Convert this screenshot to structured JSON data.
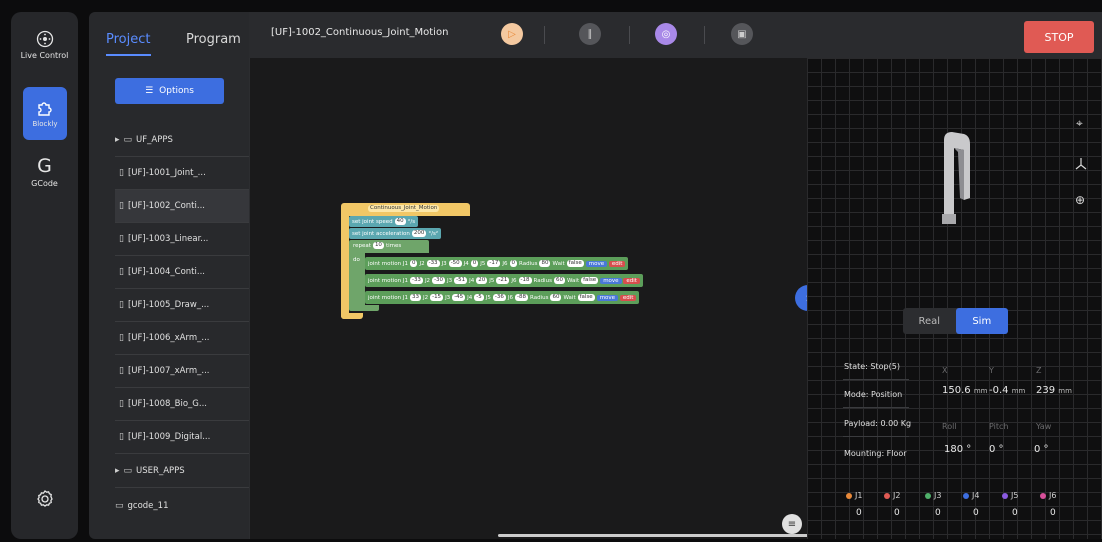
{
  "rail": {
    "live_control": "Live Control",
    "blockly": "Blockly",
    "gcode_glyph": "G",
    "gcode": "GCode"
  },
  "tabs": {
    "project": "Project",
    "program": "Program"
  },
  "options_label": "Options",
  "tree": {
    "uf_apps": "UF_APPS",
    "files": [
      "[UF]-1001_Joint_...",
      "[UF]-1002_Conti...",
      "[UF]-1003_Linear...",
      "[UF]-1004_Conti...",
      "[UF]-1005_Draw_...",
      "[UF]-1006_xArm_...",
      "[UF]-1007_xArm_...",
      "[UF]-1008_Bio_G...",
      "[UF]-1009_Digital..."
    ],
    "user_apps": "USER_APPS",
    "gcode_file": "gcode_11"
  },
  "toolbar": {
    "title": "[UF]-1002_Continuous_Joint_Motion",
    "stop": "STOP"
  },
  "blocks": {
    "func_name": "Continuous_Joint_Motion",
    "speed_label": "set joint speed",
    "speed_val": "40",
    "speed_unit": "°/s",
    "acc_label": "set joint acceleration",
    "acc_val": "200",
    "acc_unit": "°/s²",
    "repeat_label": "repeat",
    "repeat_val": "10",
    "times": "times",
    "do": "do",
    "motions": [
      {
        "j": [
          "0",
          "-33",
          "-50",
          "0",
          "-17",
          "0"
        ],
        "radius": "80",
        "wait": "false",
        "move": "move",
        "edit": "edit"
      },
      {
        "j": [
          "-33",
          "-30",
          "-51",
          "20",
          "-21",
          "-18"
        ],
        "radius": "60",
        "wait": "false",
        "move": "move",
        "edit": "edit"
      },
      {
        "j": [
          "33",
          "-15",
          "-45",
          "-5",
          "-36",
          "-88"
        ],
        "radius": "60",
        "wait": "false",
        "move": "move",
        "edit": "edit"
      }
    ]
  },
  "sim": {
    "real": "Real",
    "sim": "Sim",
    "state": "State: Stop(5)",
    "mode": "Mode: Position",
    "payload": "Payload: 0.00 Kg",
    "mounting": "Mounting: Floor",
    "x_label": "X",
    "y_label": "Y",
    "z_label": "Z",
    "x": "150.6",
    "x_unit": "mm",
    "y": "-0.4",
    "y_unit": "mm",
    "z": "239",
    "z_unit": "mm",
    "roll_label": "Roll",
    "pitch_label": "Pitch",
    "yaw_label": "Yaw",
    "roll": "180 °",
    "pitch": "0 °",
    "yaw": "0 °",
    "joints": [
      {
        "name": "J1",
        "value": "0",
        "color": "#e8893a"
      },
      {
        "name": "J2",
        "value": "0",
        "color": "#e05a54"
      },
      {
        "name": "J3",
        "value": "0",
        "color": "#4fb06a"
      },
      {
        "name": "J4",
        "value": "0",
        "color": "#3d6ee0"
      },
      {
        "name": "J5",
        "value": "0",
        "color": "#8a5ae0"
      },
      {
        "name": "J6",
        "value": "0",
        "color": "#d8509a"
      }
    ]
  }
}
